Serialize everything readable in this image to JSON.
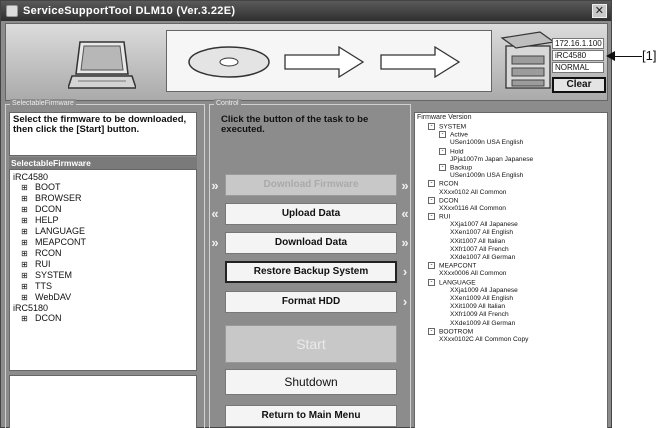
{
  "window": {
    "title": "ServiceSupportTool DLM10 (Ver.3.22E)",
    "close_glyph": "✕"
  },
  "device": {
    "ip": "172.16.1.100",
    "model": "iRC4580",
    "mode": "NORMAL",
    "clear_label": "Clear"
  },
  "left_panel": {
    "group_label": "SelectableFirmware",
    "instruction": "Select the firmware to be downloaded, then click the [Start] button.",
    "header": "SelectableFirmware",
    "devices": [
      {
        "name": "iRC4580",
        "items": [
          "BOOT",
          "BROWSER",
          "DCON",
          "HELP",
          "LANGUAGE",
          "MEAPCONT",
          "RCON",
          "RUI",
          "SYSTEM",
          "TTS",
          "WebDAV"
        ]
      },
      {
        "name": "iRC5180",
        "items": [
          "DCON"
        ]
      }
    ]
  },
  "control": {
    "group_label": "Control",
    "instruction": "Click the button of the task to be executed.",
    "buttons": {
      "download_firmware": "Download Firmware",
      "upload_data": "Upload Data",
      "download_data": "Download Data",
      "restore_backup": "Restore Backup System",
      "format_hdd": "Format HDD",
      "start": "Start",
      "shutdown": "Shutdown",
      "return_main": "Return to Main Menu"
    }
  },
  "firmware_version": {
    "title": "Firmware Version",
    "rows": [
      {
        "indent": 1,
        "box": "-",
        "text": "SYSTEM"
      },
      {
        "indent": 2,
        "box": "-",
        "text": "Active"
      },
      {
        "indent": 3,
        "box": "",
        "text": "USen1009n USA English"
      },
      {
        "indent": 2,
        "box": "-",
        "text": "Hold"
      },
      {
        "indent": 3,
        "box": "",
        "text": "JPja1007m Japan Japanese"
      },
      {
        "indent": 2,
        "box": "-",
        "text": "Backup"
      },
      {
        "indent": 3,
        "box": "",
        "text": "USen1009n USA English"
      },
      {
        "indent": 1,
        "box": "-",
        "text": "RCON"
      },
      {
        "indent": 2,
        "box": "",
        "text": "XXxx0102 All Common"
      },
      {
        "indent": 1,
        "box": "-",
        "text": "DCON"
      },
      {
        "indent": 2,
        "box": "",
        "text": "XXxx0116 All Common"
      },
      {
        "indent": 1,
        "box": "-",
        "text": "RUI"
      },
      {
        "indent": 3,
        "box": "",
        "text": "XXja1007 All Japanese"
      },
      {
        "indent": 3,
        "box": "",
        "text": "XXen1007 All English"
      },
      {
        "indent": 3,
        "box": "",
        "text": "XXit1007 All Italian"
      },
      {
        "indent": 3,
        "box": "",
        "text": "XXfr1007 All French"
      },
      {
        "indent": 3,
        "box": "",
        "text": "XXde1007 All German"
      },
      {
        "indent": 1,
        "box": "-",
        "text": "MEAPCONT"
      },
      {
        "indent": 2,
        "box": "",
        "text": "XXxx0006 All Common"
      },
      {
        "indent": 1,
        "box": "-",
        "text": "LANGUAGE"
      },
      {
        "indent": 3,
        "box": "",
        "text": "XXja1009 All Japanese"
      },
      {
        "indent": 3,
        "box": "",
        "text": "XXen1009 All English"
      },
      {
        "indent": 3,
        "box": "",
        "text": "XXit1009 All Italian"
      },
      {
        "indent": 3,
        "box": "",
        "text": "XXfr1009 All French"
      },
      {
        "indent": 3,
        "box": "",
        "text": "XXde1009 All German"
      },
      {
        "indent": 1,
        "box": "-",
        "text": "BOOTROM"
      },
      {
        "indent": 2,
        "box": "",
        "text": "XXxx0102C All Common Copy"
      }
    ]
  },
  "callout": {
    "label": "[1]"
  },
  "colors": {
    "window_bg": "#8c8c8c",
    "titlebar": "#3a3a3a"
  }
}
